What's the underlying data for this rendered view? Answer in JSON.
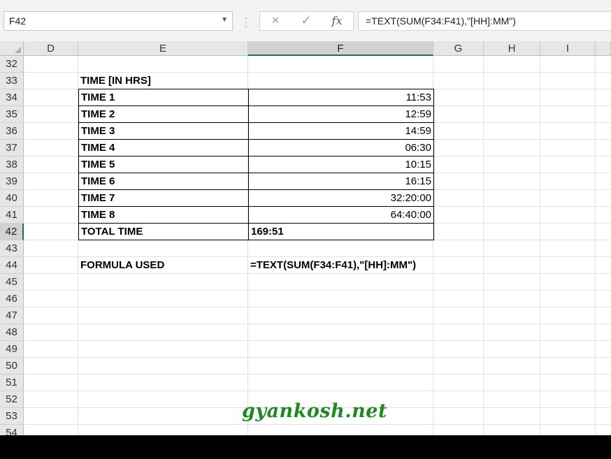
{
  "namebox": {
    "value": "F42"
  },
  "formula_bar": {
    "cancel_icon": "×",
    "enter_icon": "✓",
    "insert_function_label": "fx",
    "formula": "=TEXT(SUM(F34:F41),\"[HH]:MM\")"
  },
  "columns": [
    "D",
    "E",
    "F",
    "G",
    "H",
    "I"
  ],
  "selected_column": "F",
  "rows": [
    "32",
    "33",
    "34",
    "35",
    "36",
    "37",
    "38",
    "39",
    "40",
    "41",
    "42",
    "43",
    "44",
    "45",
    "46",
    "47",
    "48",
    "49",
    "50",
    "51",
    "52",
    "53",
    "54"
  ],
  "selected_row": "42",
  "table": {
    "header": "TIME [IN HRS]",
    "items": [
      {
        "label": "TIME 1",
        "value": "11:53"
      },
      {
        "label": "TIME 2",
        "value": "12:59"
      },
      {
        "label": "TIME 3",
        "value": "14:59"
      },
      {
        "label": "TIME 4",
        "value": "06:30"
      },
      {
        "label": "TIME 5",
        "value": "10:15"
      },
      {
        "label": "TIME 6",
        "value": "16:15"
      },
      {
        "label": "TIME 7",
        "value": "32:20:00"
      },
      {
        "label": "TIME 8",
        "value": "64:40:00"
      }
    ],
    "total_label": "TOTAL TIME",
    "total_value": "169:51"
  },
  "formula_note": {
    "label": "FORMULA USED",
    "value": "=TEXT(SUM(F34:F41),\"[HH]:MM\")"
  },
  "watermark": "gyankosh.net",
  "colors": {
    "accent": "#217346",
    "watermark": "#1f8a1f"
  }
}
